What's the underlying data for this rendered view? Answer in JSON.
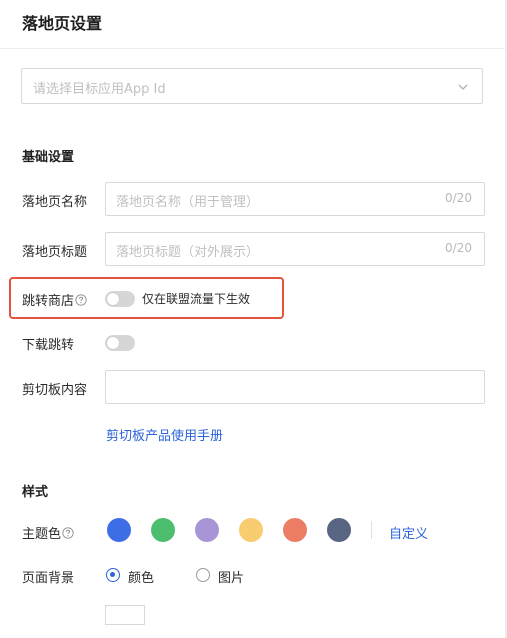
{
  "header": {
    "title": "落地页设置"
  },
  "app_select": {
    "placeholder": "请选择目标应用App Id"
  },
  "basic": {
    "title": "基础设置",
    "landing_name": {
      "label": "落地页名称",
      "placeholder": "落地页名称（用于管理）",
      "count": "0/20"
    },
    "landing_title": {
      "label": "落地页标题",
      "placeholder": "落地页标题（对外展示）",
      "count": "0/20"
    },
    "jump_store": {
      "label": "跳转商店",
      "enabled": false,
      "hint": "仅在联盟流量下生效"
    },
    "download_jump": {
      "label": "下载跳转",
      "enabled": false
    },
    "clipboard": {
      "label": "剪切板内容",
      "value": "",
      "manual_link": "剪切板产品使用手册"
    }
  },
  "style": {
    "title": "样式",
    "theme": {
      "label": "主题色",
      "colors": [
        "#3d6ee6",
        "#4dbe6e",
        "#a895d6",
        "#f7cd6f",
        "#ec7c63",
        "#586583"
      ],
      "custom_label": "自定义"
    },
    "background": {
      "label": "页面背景",
      "options": [
        {
          "label": "颜色",
          "selected": true
        },
        {
          "label": "图片",
          "selected": false
        }
      ]
    }
  }
}
